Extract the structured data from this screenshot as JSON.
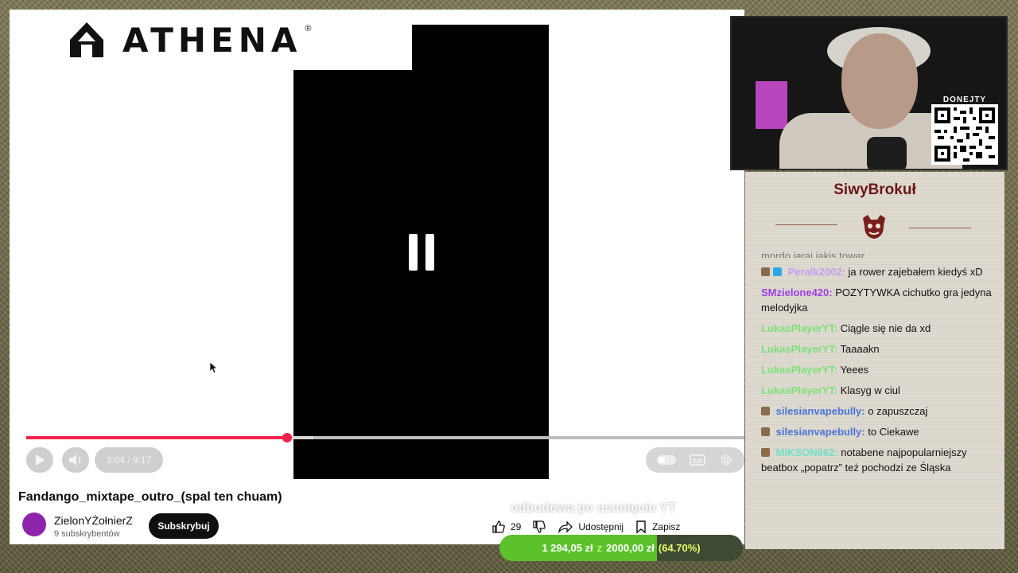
{
  "brand": {
    "name": "ATHENA",
    "reg": "®"
  },
  "player": {
    "time": "3:04 / 9:17",
    "progress_fraction": 0.363,
    "buffer_fraction": 0.4
  },
  "video": {
    "title": "Fandango_mixtape_outro_(spal ten chuam)",
    "channel": "ZielonYŻołnierZ",
    "subscribers": "9 subskrybentów",
    "subscribe_label": "Subskrybuj",
    "likes": "29",
    "share_label": "Udostępnij",
    "save_label": "Zapisz"
  },
  "overlay": {
    "text": "odbudowa po usunięciu YT"
  },
  "goal": {
    "current": "1 294,05 zł",
    "of": "z",
    "target": "2000,00 zł",
    "percent_label": "(64.70%)",
    "fraction": 0.647,
    "color": "#5cc22c"
  },
  "cam": {
    "qr_label": "DONEJTY"
  },
  "chat": {
    "streamer": "SiwyBrokuł",
    "messages": [
      {
        "user": "",
        "text": "mordo jaraj jakis towar",
        "color": "#111111",
        "faded": true
      },
      {
        "user": "Peralk2002:",
        "text": "ja rower zajebałem kiedyś xD",
        "color": "#c79bf0",
        "badge": true
      },
      {
        "user": "SMzielone420:",
        "text": "POZYTYWKA cichutko gra jedyna melodyjka",
        "color": "#9b3fe0"
      },
      {
        "user": "LukasPlayerYT:",
        "text": "Ciągle się nie da xd",
        "color": "#7fe07a"
      },
      {
        "user": "LukasPlayerYT:",
        "text": "Taaaakn",
        "color": "#7fe07a"
      },
      {
        "user": "LukasPlayerYT:",
        "text": "Yeees",
        "color": "#7fe07a"
      },
      {
        "user": "LukasPlayerYT:",
        "text": "Klasyg w ciul",
        "color": "#7fe07a"
      },
      {
        "user": "silesianvapebully:",
        "text": "o zapuszczaj",
        "color": "#4a73d6",
        "badge": true
      },
      {
        "user": "silesianvapebully:",
        "text": "to Ciekawe",
        "color": "#4a73d6",
        "badge": true
      },
      {
        "user": "MIKSON662:",
        "text": "notabene najpopularniejszy beatbox „popatrz” też pochodzi ze Śląska",
        "color": "#6ee0c8",
        "badge": true
      }
    ]
  },
  "colors": {
    "accent_red": "#f2234b",
    "chat_name": "#6b1717"
  }
}
